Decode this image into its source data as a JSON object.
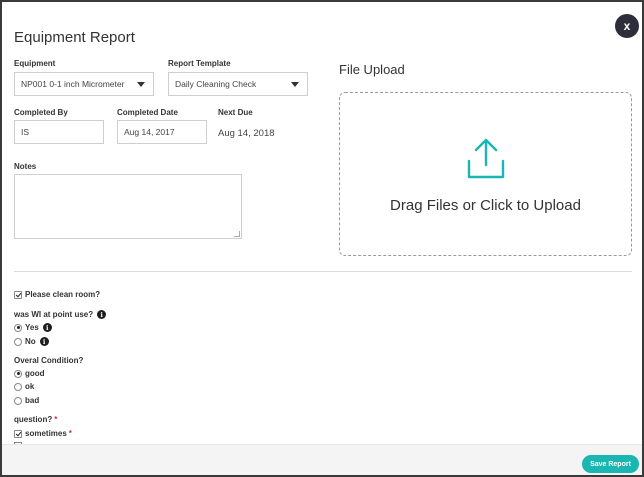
{
  "modal": {
    "title": "Equipment Report",
    "close_label": "x"
  },
  "form": {
    "equipment": {
      "label": "Equipment",
      "value": "NP001 0-1 inch Micrometer"
    },
    "report_template": {
      "label": "Report Template",
      "value": "Daily Cleaning Check"
    },
    "completed_by": {
      "label": "Completed By",
      "value": "IS"
    },
    "completed_date": {
      "label": "Completed Date",
      "value": "Aug 14, 2017"
    },
    "next_due": {
      "label": "Next Due",
      "value": "Aug 14, 2018"
    },
    "notes": {
      "label": "Notes",
      "value": ""
    }
  },
  "upload": {
    "title": "File Upload",
    "prompt": "Drag Files or Click to Upload",
    "icon": "upload-icon",
    "accent_color": "#19b6b2"
  },
  "checklist": {
    "clean_room": {
      "label": "Please clean room?",
      "checked": true
    },
    "wi": {
      "question": "was WI at point use?",
      "options": [
        {
          "label": "Yes",
          "selected": true
        },
        {
          "label": "No",
          "selected": false
        }
      ]
    },
    "condition": {
      "question": "Overal Condition?",
      "options": [
        {
          "label": "good",
          "selected": true
        },
        {
          "label": "ok",
          "selected": false
        },
        {
          "label": "bad",
          "selected": false
        }
      ]
    },
    "question": {
      "label": "question?",
      "required_mark": "*",
      "options": [
        {
          "label": "sometimes",
          "required_mark": "*",
          "checked": true
        }
      ]
    }
  },
  "footer": {
    "save_label": "Save Report",
    "save_color": "#19b6b2"
  }
}
